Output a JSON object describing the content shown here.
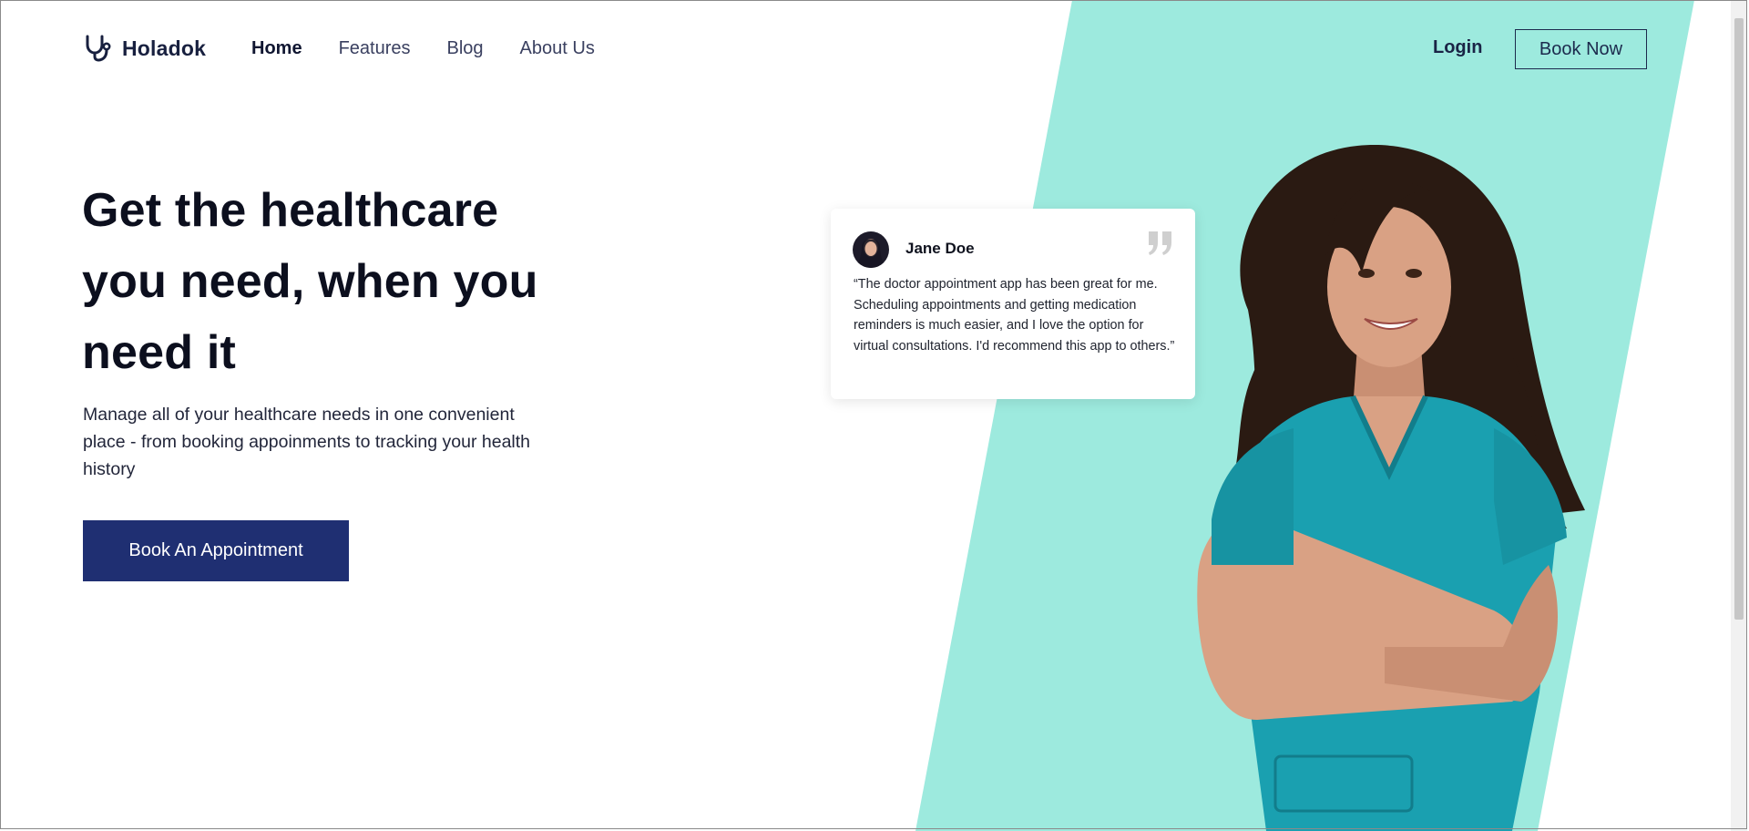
{
  "brand": {
    "name": "Holadok",
    "icon": "stethoscope-icon"
  },
  "nav": {
    "items": [
      {
        "label": "Home",
        "active": true
      },
      {
        "label": "Features",
        "active": false
      },
      {
        "label": "Blog",
        "active": false
      },
      {
        "label": "About Us",
        "active": false
      }
    ],
    "login_label": "Login",
    "book_now_label": "Book Now"
  },
  "hero": {
    "title": "Get the healthcare you need, when you need it",
    "subtitle": "Manage all of your healthcare needs in one convenient place - from booking appoinments to tracking your health history",
    "cta_label": "Book An Appointment"
  },
  "testimonial": {
    "author": "Jane Doe",
    "quote": "“The doctor appointment app has been great for me. Scheduling appointments and getting medication reminders is much easier, and I love the option for virtual consultations. I'd recommend this app to others.”",
    "icon": "quote-icon"
  },
  "colors": {
    "accent_teal": "#9deade",
    "primary_navy": "#1f2f72",
    "scrub_teal": "#1aa0b0"
  }
}
